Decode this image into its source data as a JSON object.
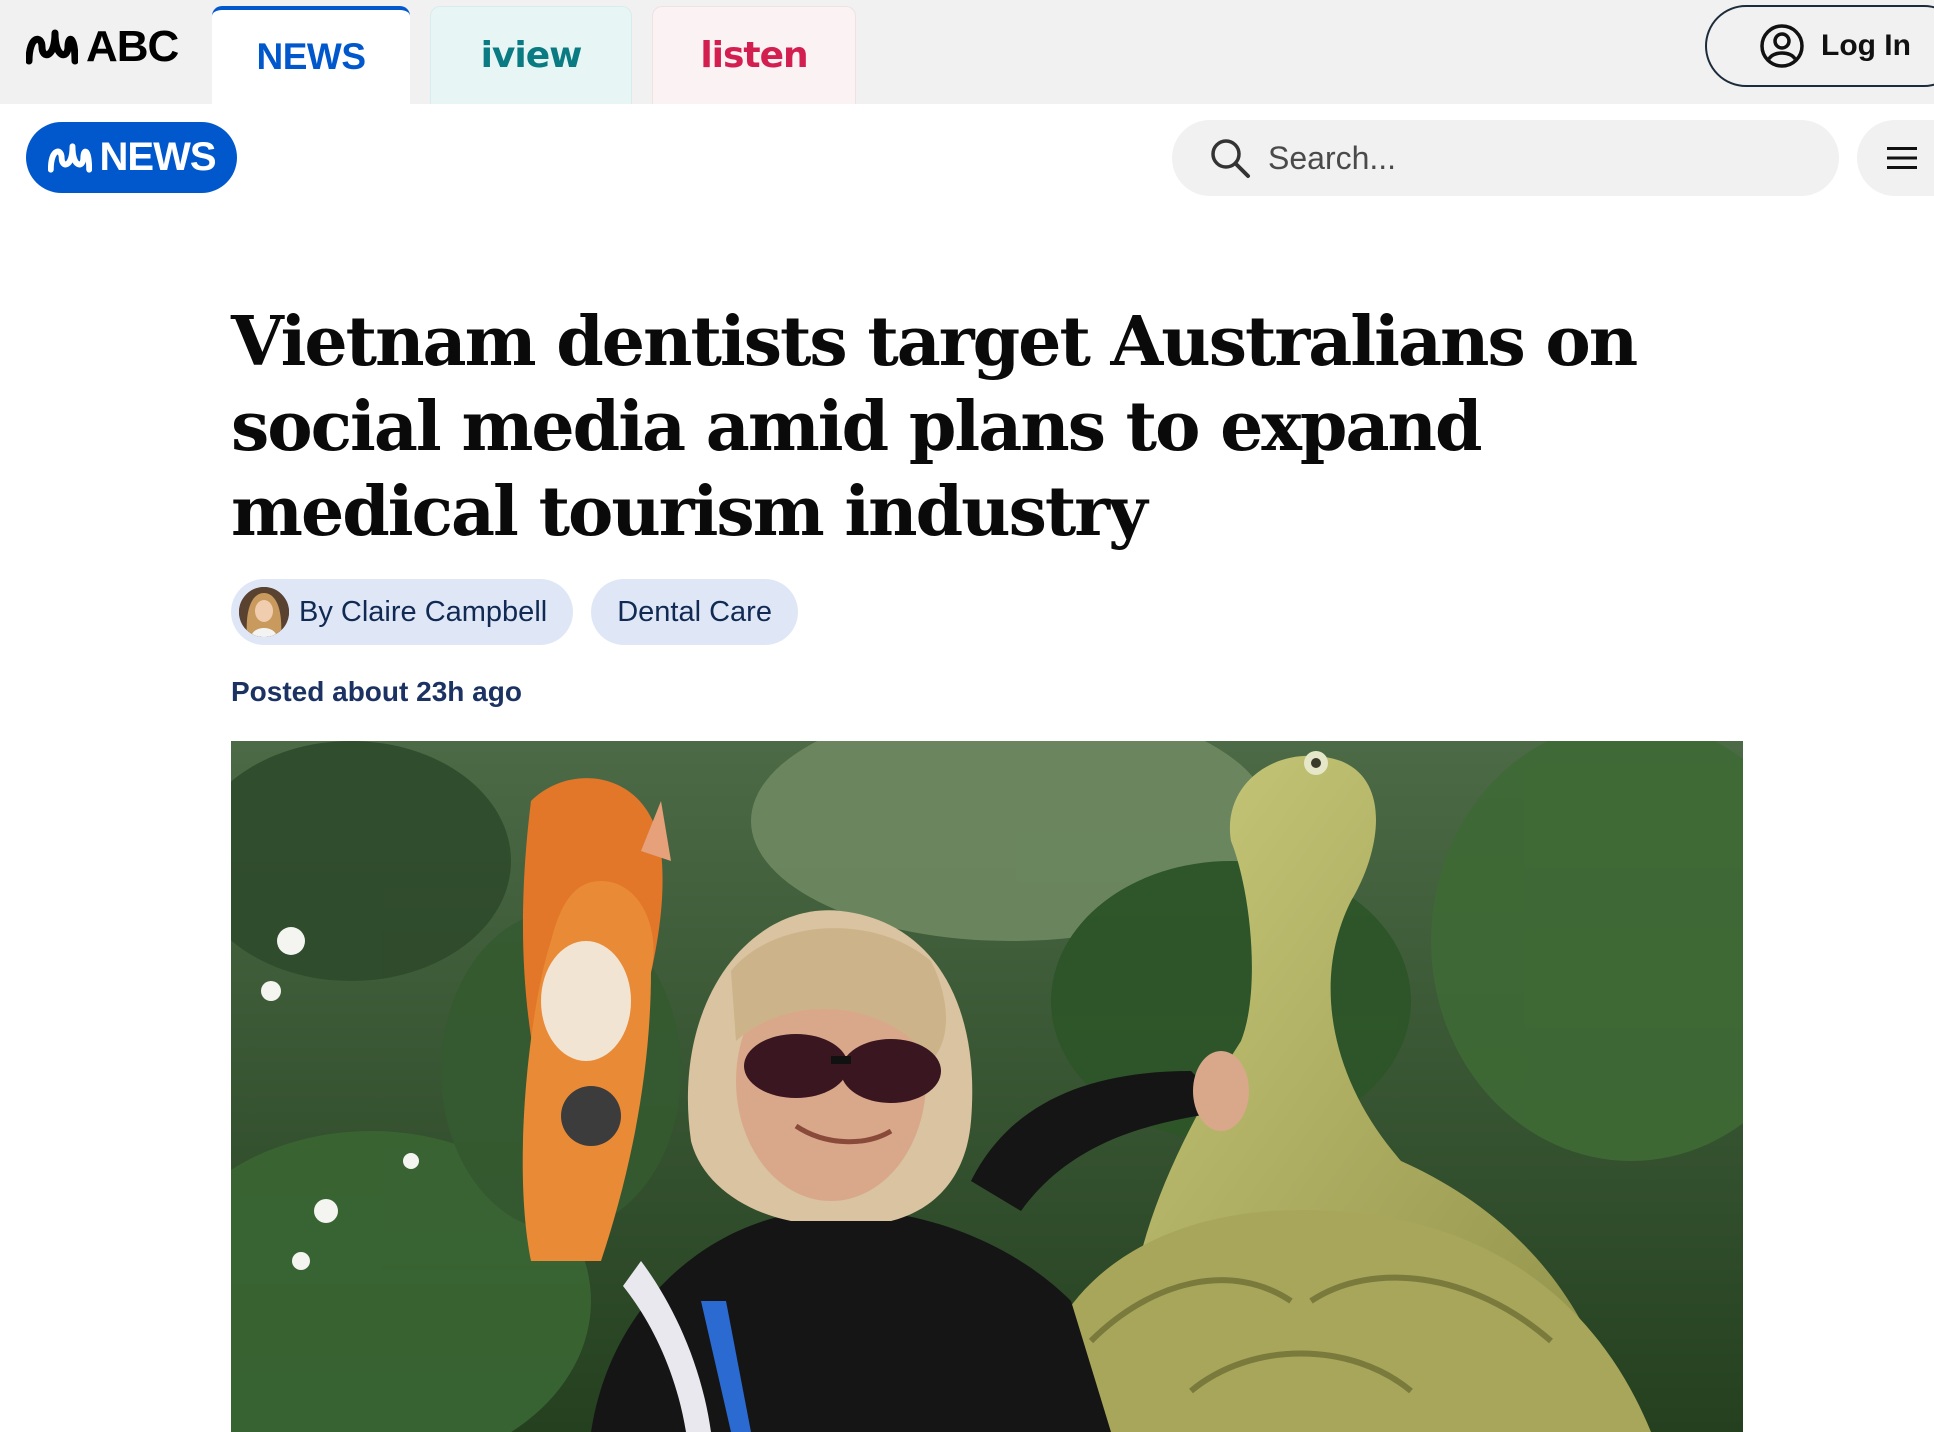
{
  "header": {
    "brand": "ABC",
    "tabs": [
      {
        "label": "NEWS"
      },
      {
        "label": "iview"
      },
      {
        "label": "listen"
      }
    ],
    "login_label": "Log In"
  },
  "newsbar": {
    "brand": "NEWS",
    "search": {
      "placeholder": "Search..."
    }
  },
  "article": {
    "headline": "Vietnam dentists target Australians on social media amid plans to expand medical tourism industry",
    "author_label": "By Claire Campbell",
    "topic_label": "Dental Care",
    "posted": "Posted about 23h ago"
  },
  "colors": {
    "abc_blue": "#0058cc",
    "iview_teal": "#0a7b83",
    "listen_red": "#d21f4f",
    "chip_bg": "#dfe7f6"
  },
  "icons": [
    "abc-lissajous-icon",
    "user-circle-icon",
    "search-icon",
    "hamburger-menu-icon"
  ]
}
